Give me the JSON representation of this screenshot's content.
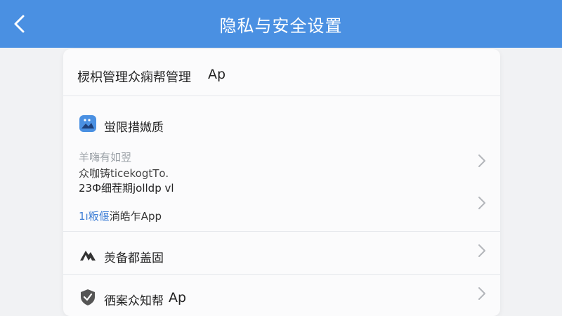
{
  "header": {
    "title": "隐私与安全设置"
  },
  "card": {
    "top_row": {
      "label": "棂枳管理众痫帮管理",
      "suffix": "Ap"
    },
    "section": {
      "title": "蛍限措媺质",
      "line1": "羊嗨有如翌",
      "line2": "众咖铸ticekogtТo.",
      "line3": "23Ф细茬期jolldp vl",
      "link": "1ı粄偃",
      "link_tail": "淌皓乍App"
    },
    "row_security": {
      "label": "羙备都盖固"
    },
    "row_bottom": {
      "label": "徆案众知帮",
      "suffix": "Ap"
    }
  },
  "colors": {
    "header_bg": "#4a90e2",
    "link": "#3f7fd6"
  }
}
